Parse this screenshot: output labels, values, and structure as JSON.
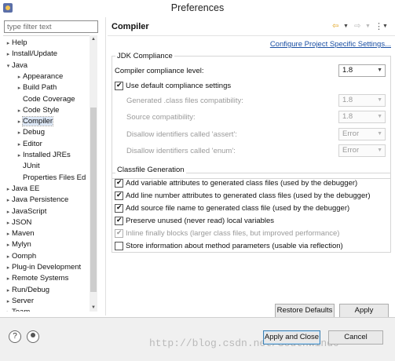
{
  "window": {
    "title": "Preferences"
  },
  "filter": {
    "placeholder": "type filter text"
  },
  "tree": [
    {
      "label": "Help",
      "arrow": "▸",
      "indent": 0
    },
    {
      "label": "Install/Update",
      "arrow": "▸",
      "indent": 0
    },
    {
      "label": "Java",
      "arrow": "▾",
      "indent": 0
    },
    {
      "label": "Appearance",
      "arrow": "▸",
      "indent": 1
    },
    {
      "label": "Build Path",
      "arrow": "▸",
      "indent": 1
    },
    {
      "label": "Code Coverage",
      "arrow": "",
      "indent": 1
    },
    {
      "label": "Code Style",
      "arrow": "▸",
      "indent": 1
    },
    {
      "label": "Compiler",
      "arrow": "▸",
      "indent": 1,
      "selected": true
    },
    {
      "label": "Debug",
      "arrow": "▸",
      "indent": 1
    },
    {
      "label": "Editor",
      "arrow": "▸",
      "indent": 1
    },
    {
      "label": "Installed JREs",
      "arrow": "▸",
      "indent": 1
    },
    {
      "label": "JUnit",
      "arrow": "",
      "indent": 1
    },
    {
      "label": "Properties Files Ed",
      "arrow": "",
      "indent": 1
    },
    {
      "label": "Java EE",
      "arrow": "▸",
      "indent": 0
    },
    {
      "label": "Java Persistence",
      "arrow": "▸",
      "indent": 0
    },
    {
      "label": "JavaScript",
      "arrow": "▸",
      "indent": 0
    },
    {
      "label": "JSON",
      "arrow": "▸",
      "indent": 0
    },
    {
      "label": "Maven",
      "arrow": "▸",
      "indent": 0
    },
    {
      "label": "Mylyn",
      "arrow": "▸",
      "indent": 0
    },
    {
      "label": "Oomph",
      "arrow": "▸",
      "indent": 0
    },
    {
      "label": "Plug-in Development",
      "arrow": "▸",
      "indent": 0
    },
    {
      "label": "Remote Systems",
      "arrow": "▸",
      "indent": 0
    },
    {
      "label": "Run/Debug",
      "arrow": "▸",
      "indent": 0
    },
    {
      "label": "Server",
      "arrow": "▸",
      "indent": 0
    },
    {
      "label": "Team",
      "arrow": "▸",
      "indent": 0
    }
  ],
  "page": {
    "title": "Compiler",
    "config_link": "Configure Project Specific Settings..."
  },
  "jdk": {
    "group_title": "JDK Compliance",
    "level_label": "Compiler compliance level:",
    "level_value": "1.8",
    "use_default_label": "Use default compliance settings",
    "use_default_checked": true,
    "generated_label": "Generated .class files compatibility:",
    "generated_value": "1.8",
    "source_label": "Source compatibility:",
    "source_value": "1.8",
    "assert_label": "Disallow identifiers called 'assert':",
    "assert_value": "Error",
    "enum_label": "Disallow identifiers called 'enum':",
    "enum_value": "Error"
  },
  "classfile": {
    "group_title": "Classfile Generation",
    "options": [
      {
        "label": "Add variable attributes to generated class files (used by the debugger)",
        "checked": true,
        "enabled": true
      },
      {
        "label": "Add line number attributes to generated class files (used by the debugger)",
        "checked": true,
        "enabled": true
      },
      {
        "label": "Add source file name to generated class file (used by the debugger)",
        "checked": true,
        "enabled": true
      },
      {
        "label": "Preserve unused (never read) local variables",
        "checked": true,
        "enabled": true
      },
      {
        "label": "Inline finally blocks (larger class files, but improved performance)",
        "checked": true,
        "enabled": false
      },
      {
        "label": "Store information about method parameters (usable via reflection)",
        "checked": false,
        "enabled": true
      }
    ]
  },
  "buttons": {
    "restore_defaults": "Restore Defaults",
    "apply": "Apply",
    "apply_and_close": "Apply and Close",
    "cancel": "Cancel"
  },
  "footer": {
    "help_glyph": "?",
    "watermark": "http://blog.csdn.net/SouthWind0"
  }
}
